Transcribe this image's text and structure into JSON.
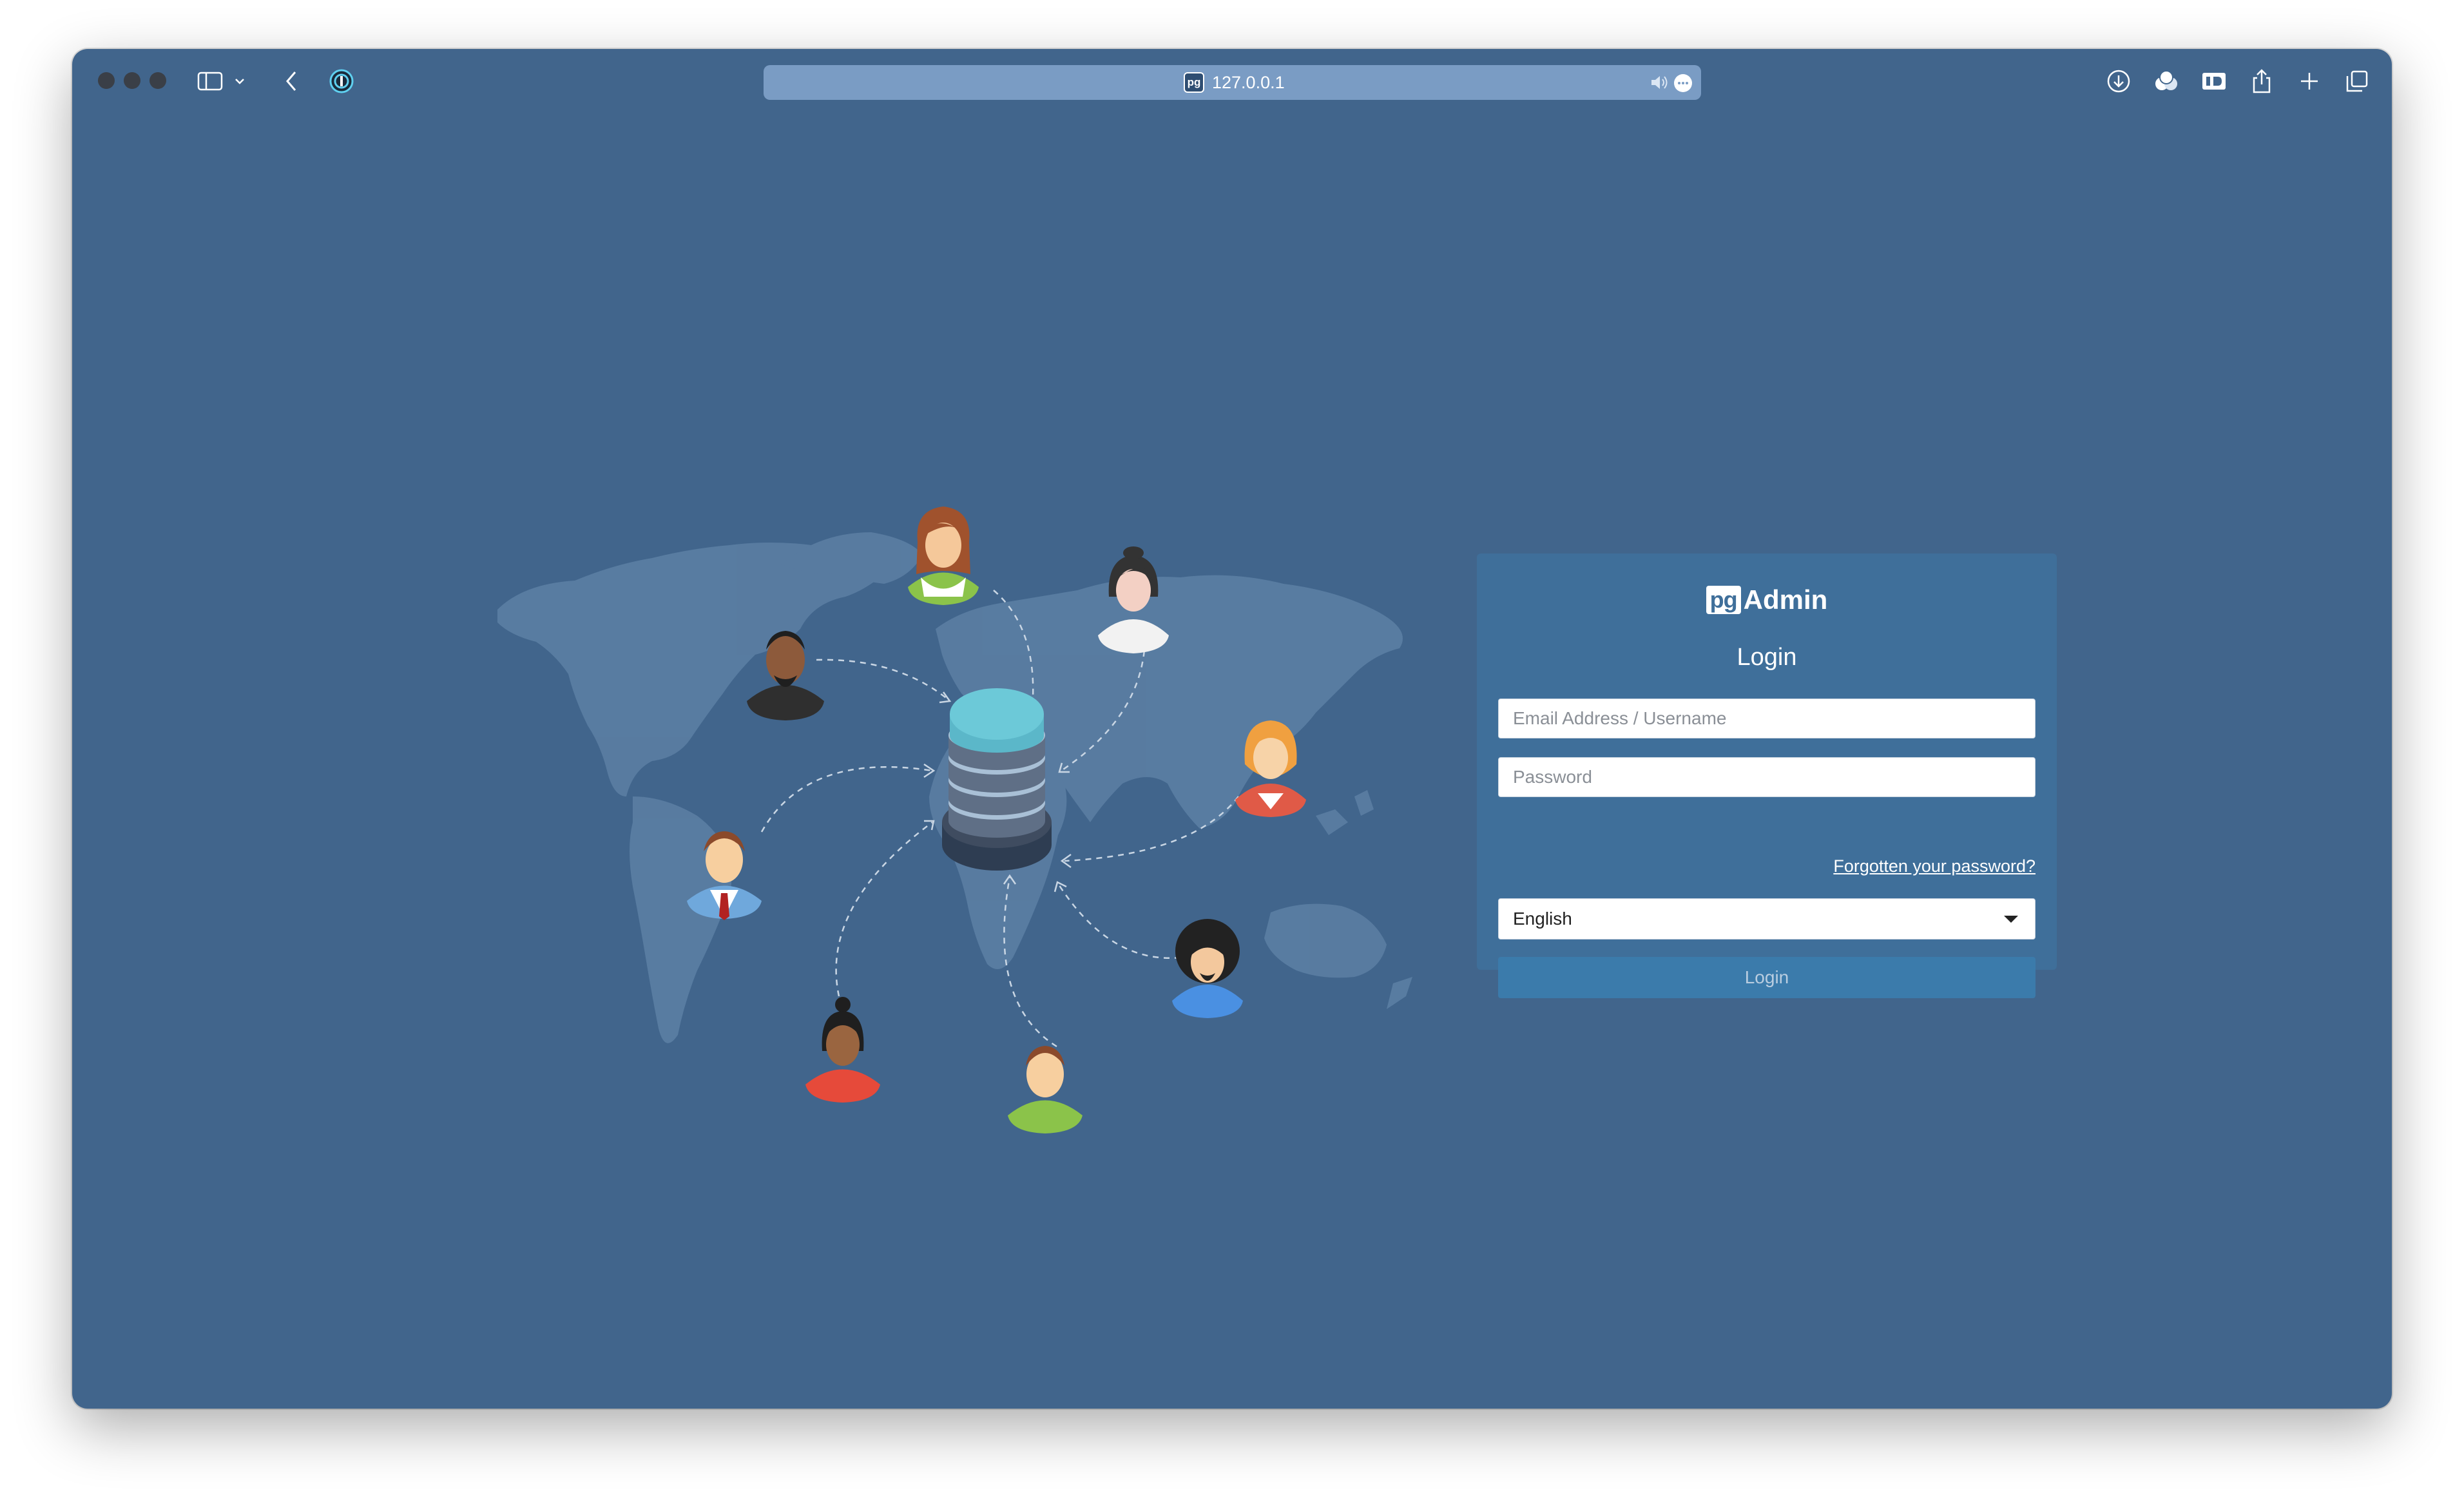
{
  "browser": {
    "url": "127.0.0.1",
    "favicon_label": "pg",
    "toolbar_icons": [
      "sidebar-icon",
      "chevron-down-icon",
      "back-icon",
      "password-manager-icon",
      "speaker-icon",
      "more-icon",
      "download-icon",
      "extensions-icon",
      "reader-icon",
      "share-icon",
      "new-tab-icon",
      "tabs-overview-icon"
    ]
  },
  "illustration": {
    "description_icons": [
      "world-map",
      "database-icon",
      "user-avatar"
    ]
  },
  "login": {
    "logo_pg": "pg",
    "logo_text": "Admin",
    "title": "Login",
    "email_placeholder": "Email Address / Username",
    "email_value": "",
    "password_placeholder": "Password",
    "password_value": "",
    "forgot_link": "Forgotten your password?",
    "language_selected": "English",
    "submit_label": "Login"
  },
  "colors": {
    "background": "#41658c",
    "panel": "#3f6f9a",
    "button": "#3b7bab",
    "database_top": "#6cc9d8"
  }
}
